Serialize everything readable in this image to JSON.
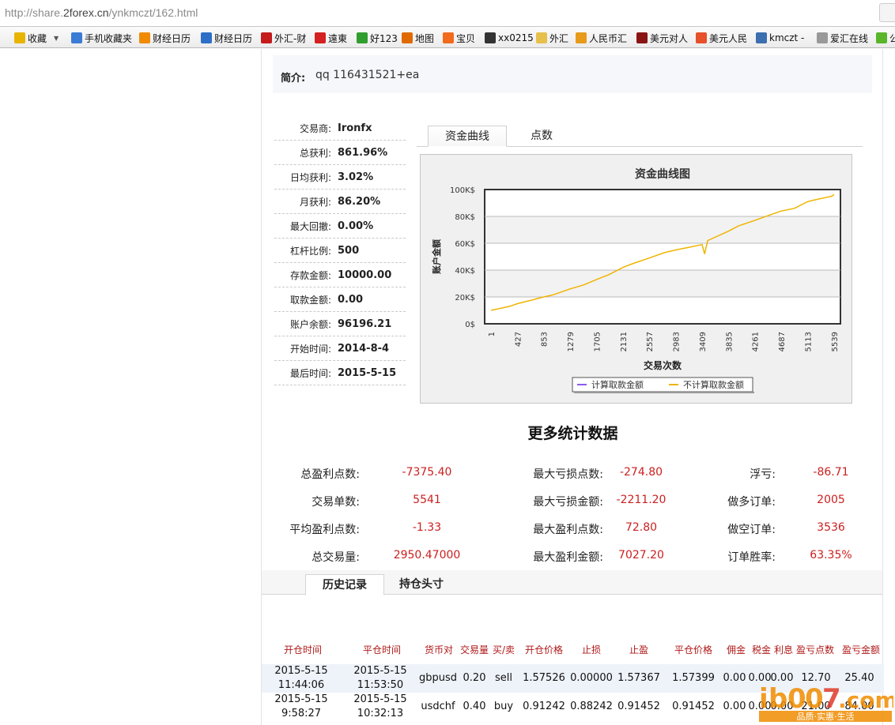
{
  "browser": {
    "url_prefix": "http://share.",
    "url_domain": "2forex.cn",
    "url_path": "/ynkmczt/162.html",
    "bookmarks": [
      {
        "label": "收藏",
        "icon": "star-icon",
        "color": "#e8b400"
      },
      {
        "label": "手机收藏夹",
        "icon": "phone-icon",
        "color": "#3a7bd5"
      },
      {
        "label": "财经日历",
        "icon": "calendar-icon",
        "color": "#f08a00"
      },
      {
        "label": "财经日历",
        "icon": "globe-icon",
        "color": "#2d6fc7"
      },
      {
        "label": "外汇-财",
        "icon": "flag-icon",
        "color": "#c41b1b"
      },
      {
        "label": "遠東",
        "icon": "diamond-icon",
        "color": "#d42020"
      },
      {
        "label": "好123",
        "icon": "check-icon",
        "color": "#2f9e2f"
      },
      {
        "label": "地图",
        "icon": "map-icon",
        "color": "#e06a00"
      },
      {
        "label": "宝贝",
        "icon": "taobao-icon",
        "color": "#f26b1d"
      },
      {
        "label": "xx0215",
        "icon": "circle-icon",
        "color": "#333"
      },
      {
        "label": "外汇",
        "icon": "folder-icon",
        "color": "#e6c04a"
      },
      {
        "label": "人民币汇",
        "icon": "bird-icon",
        "color": "#e89a1a"
      },
      {
        "label": "美元对人",
        "icon": "book-icon",
        "color": "#8a1414"
      },
      {
        "label": "美元人民",
        "icon": "fish-icon",
        "color": "#e6502a"
      },
      {
        "label": "kmczt -",
        "icon": "number-icon",
        "color": "#3b6fb0"
      },
      {
        "label": "爱汇在线",
        "icon": "page-icon",
        "color": "#999"
      },
      {
        "label": "公",
        "icon": "chat-icon",
        "color": "#5ab52a"
      }
    ]
  },
  "intro": {
    "label": "简介:",
    "value": "qq 116431521+ea"
  },
  "stats": [
    {
      "key": "交易商:",
      "value": "Ironfx"
    },
    {
      "key": "总获利:",
      "value": "861.96%"
    },
    {
      "key": "日均获利:",
      "value": "3.02%"
    },
    {
      "key": "月获利:",
      "value": "86.20%"
    },
    {
      "key": "最大回撤:",
      "value": "0.00%"
    },
    {
      "key": "杠杆比例:",
      "value": "500"
    },
    {
      "key": "存款金额:",
      "value": "10000.00"
    },
    {
      "key": "取款金额:",
      "value": "0.00"
    },
    {
      "key": "账户余额:",
      "value": "96196.21"
    },
    {
      "key": "开始时间:",
      "value": "2014-8-4"
    },
    {
      "key": "最后时间:",
      "value": "2015-5-15"
    }
  ],
  "chart_tabs": [
    "资金曲线",
    "点数"
  ],
  "chart_data": {
    "type": "line",
    "title": "资金曲线图",
    "xlabel": "交易次数",
    "ylabel": "账户金额",
    "x_ticks": [
      "1",
      "427",
      "853",
      "1279",
      "1705",
      "2131",
      "2557",
      "2983",
      "3409",
      "3835",
      "4261",
      "4687",
      "5113",
      "5539"
    ],
    "y_ticks": [
      "0$",
      "20K$",
      "40K$",
      "60K$",
      "80K$",
      "100K$"
    ],
    "ylim": [
      0,
      100000
    ],
    "xlim": [
      1,
      5541
    ],
    "grid": true,
    "legend_position": "bottom",
    "series": [
      {
        "name": "计算取款金额",
        "color": "#8a5cf0",
        "x": [],
        "y": []
      },
      {
        "name": "不计算取款金额",
        "color": "#f0b400",
        "x": [
          1,
          300,
          427,
          600,
          853,
          1000,
          1279,
          1500,
          1705,
          1900,
          2131,
          2300,
          2557,
          2800,
          2983,
          3200,
          3409,
          3450,
          3500,
          3835,
          4000,
          4261,
          4500,
          4687,
          4900,
          5113,
          5200,
          5300,
          5400,
          5500,
          5539,
          5541
        ],
        "y": [
          10000,
          13000,
          15000,
          17000,
          20000,
          21500,
          26000,
          29000,
          33000,
          36500,
          42000,
          45000,
          49000,
          53000,
          55000,
          57000,
          59000,
          52000,
          62000,
          69000,
          73000,
          77000,
          81000,
          84000,
          86000,
          91000,
          92000,
          93000,
          94000,
          95000,
          96200,
          96196
        ]
      }
    ]
  },
  "more_stats": {
    "title": "更多统计数据",
    "rows": [
      [
        {
          "k": "总盈利点数:",
          "v": "-7375.40"
        },
        {
          "k": "最大亏损点数:",
          "v": "-274.80"
        },
        {
          "k": "浮亏:",
          "v": "-86.71"
        }
      ],
      [
        {
          "k": "交易单数:",
          "v": "5541"
        },
        {
          "k": "最大亏损金额:",
          "v": "-2211.20"
        },
        {
          "k": "做多订单:",
          "v": "2005"
        }
      ],
      [
        {
          "k": "平均盈利点数:",
          "v": "-1.33"
        },
        {
          "k": "最大盈利点数:",
          "v": "72.80"
        },
        {
          "k": "做空订单:",
          "v": "3536"
        }
      ],
      [
        {
          "k": "总交易量:",
          "v": "2950.47000"
        },
        {
          "k": "最大盈利金额:",
          "v": "7027.20"
        },
        {
          "k": "订单胜率:",
          "v": "63.35%"
        }
      ]
    ]
  },
  "history_tabs": [
    "历史记录",
    "持仓头寸"
  ],
  "table": {
    "headers": [
      "开仓时间",
      "平仓时间",
      "货币对",
      "交易量",
      "买/卖",
      "开仓价格",
      "止损",
      "止盈",
      "平仓价格",
      "佣金",
      "税金",
      "利息",
      "盈亏点数",
      "盈亏金额"
    ],
    "rows": [
      {
        "open_date": "2015-5-15",
        "open_time": "11:44:06",
        "close_date": "2015-5-15",
        "close_time": "11:53:50",
        "pair": "gbpusd",
        "volume": "0.20",
        "side": "sell",
        "open_price": "1.57526",
        "sl": "0.00000",
        "tp": "1.57367",
        "close_price": "1.57399",
        "commission": "0.00",
        "tax": "0.00",
        "swap": "0.00",
        "pips": "12.70",
        "profit": "25.40"
      },
      {
        "open_date": "2015-5-15",
        "open_time": "9:58:27",
        "close_date": "2015-5-15",
        "close_time": "10:32:13",
        "pair": "usdchf",
        "volume": "0.40",
        "side": "buy",
        "open_price": "0.91242",
        "sl": "0.88242",
        "tp": "0.91452",
        "close_price": "0.91452",
        "commission": "0.00",
        "tax": "0.00",
        "swap": "0.00",
        "pips": "21.00",
        "profit": "84.00"
      }
    ]
  },
  "watermark": {
    "brand": "ib007",
    "domain": ".com",
    "slogan": "品质·实惠·生活"
  }
}
